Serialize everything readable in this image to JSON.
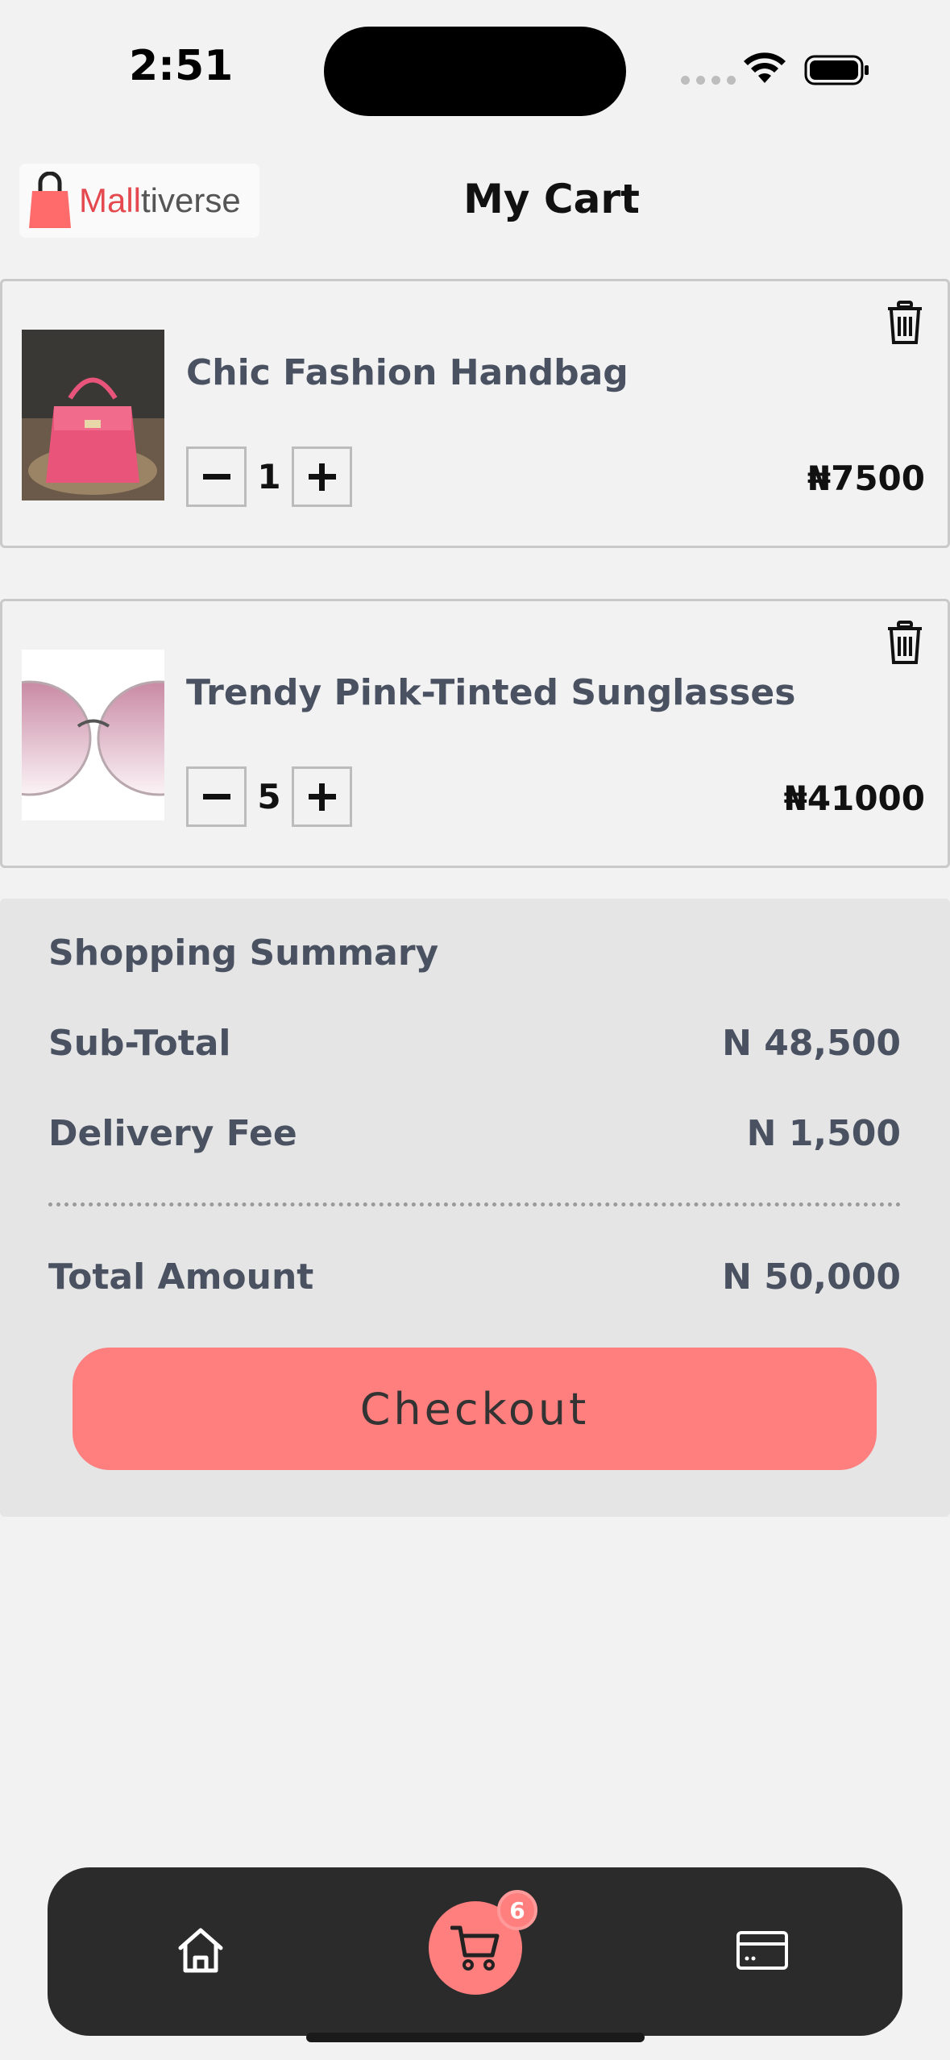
{
  "status_bar": {
    "time": "2:51"
  },
  "header": {
    "logo_part1": "Mall",
    "logo_part2": "tiverse",
    "title": "My Cart"
  },
  "cart": {
    "items": [
      {
        "name": "Chic Fashion Handbag",
        "quantity": "1",
        "price": "₦7500"
      },
      {
        "name": "Trendy Pink-Tinted Sunglasses",
        "quantity": "5",
        "price": "₦41000"
      }
    ]
  },
  "summary": {
    "heading": "Shopping Summary",
    "subtotal_label": "Sub-Total",
    "subtotal_value": "N 48,500",
    "delivery_label": "Delivery Fee",
    "delivery_value": "N 1,500",
    "total_label": "Total Amount",
    "total_value": "N 50,000",
    "checkout_label": "Checkout"
  },
  "nav": {
    "cart_badge": "6",
    "items": [
      "home-icon",
      "cart-icon",
      "card-icon"
    ]
  },
  "colors": {
    "accent": "#ff7e7e",
    "text_muted": "#4a5262",
    "nav_bg": "#2b2b2b"
  }
}
